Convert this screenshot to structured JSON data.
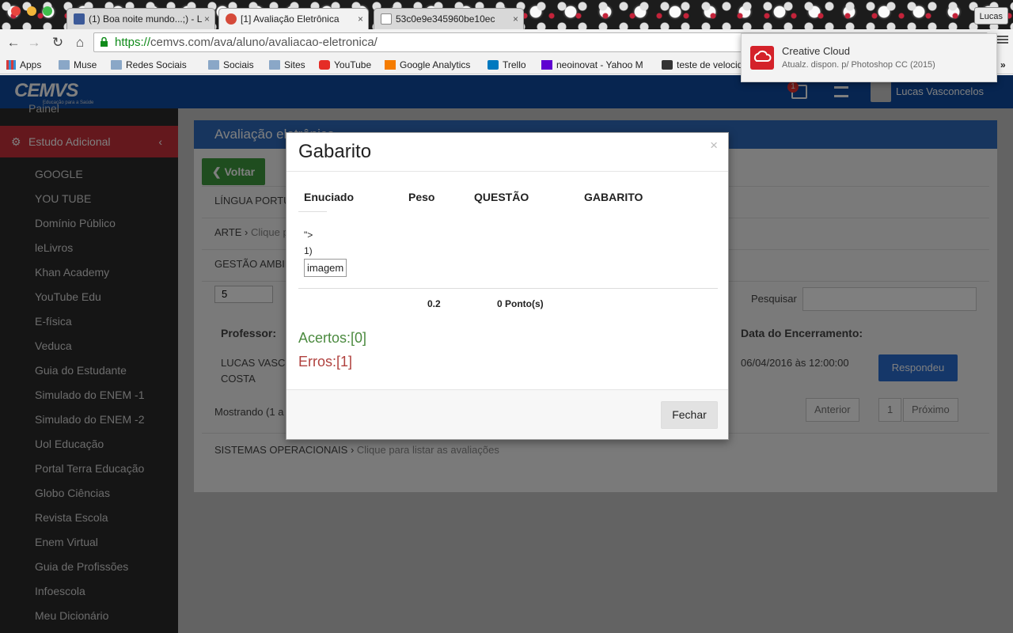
{
  "browser": {
    "tabs": [
      {
        "label": "(1) Boa noite mundo...;) - L",
        "close": "×"
      },
      {
        "label": "[1] Avaliação Eletrônica",
        "close": "×"
      },
      {
        "label": "53c0e9e345960be10ec",
        "close": "×"
      }
    ],
    "profile": "Lucas",
    "url_scheme": "https://",
    "url_rest": "cemvs.com/ava/aluno/avaliacao-eletronica/",
    "bookmarks": [
      "Apps",
      "Muse",
      "Redes Sociais",
      "Sociais",
      "Sites",
      "YouTube",
      "Google Analytics",
      "Trello",
      "neoinovat - Yahoo M",
      "teste de velocid"
    ],
    "more": "»"
  },
  "notification": {
    "title": "Creative Cloud",
    "body": "Atualz. dispon. p/ Photoshop CC (2015)"
  },
  "site": {
    "logo": "CEMVS",
    "logo_tag": "Educação para a Saúde",
    "badge": "1",
    "user": "Lucas Vasconcelos"
  },
  "sidebar": {
    "top_item": "Painel",
    "active": "Estudo Adicional",
    "items": [
      "GOOGLE",
      "YOU TUBE",
      "Domínio Público",
      "leLivros",
      "Khan Academy",
      "YouTube Edu",
      "E-física",
      "Veduca",
      "Guia do Estudante",
      "Simulado do ENEM -1",
      "Simulado do ENEM -2",
      "Uol Educação",
      "Portal Terra Educação",
      "Globo Ciências",
      "Revista Escola",
      "Enem Virtual",
      "Guia de Profissões",
      "Infoescola",
      "Meu Dicionário"
    ]
  },
  "main": {
    "panel_title": "Avaliação eletrônica",
    "back": "Voltar",
    "sections": [
      "LÍNGUA PORTU",
      "ARTE",
      "Clique p",
      "GESTÃO AMBIE"
    ],
    "length_value": "5",
    "search_label": "Pesquisar",
    "professor_header": "Professor:",
    "closing_header": "Data do Encerramento:",
    "professor_name_1": "LUCAS VASCO",
    "professor_name_2": "COSTA",
    "closing_date": "06/04/2016 às 12:00:00",
    "respond": "Respondeu",
    "showing": "Mostrando (1 a",
    "prev": "Anterior",
    "page": "1",
    "next": "Próximo",
    "last_section": "SISTEMAS OPERACIONAIS",
    "last_section_link": "Clique para listar as avaliações"
  },
  "modal": {
    "title": "Gabarito",
    "close": "×",
    "headers": [
      "Enuciado",
      "Peso",
      "QUESTÃO",
      "GABARITO"
    ],
    "statement_line1": "\">",
    "statement_line2": "1)",
    "image_alt": "imagem",
    "weight": "0.2",
    "score": "0 Ponto(s)",
    "hits": "Acertos:[0]",
    "errors": "Erros:[1]",
    "button": "Fechar"
  }
}
